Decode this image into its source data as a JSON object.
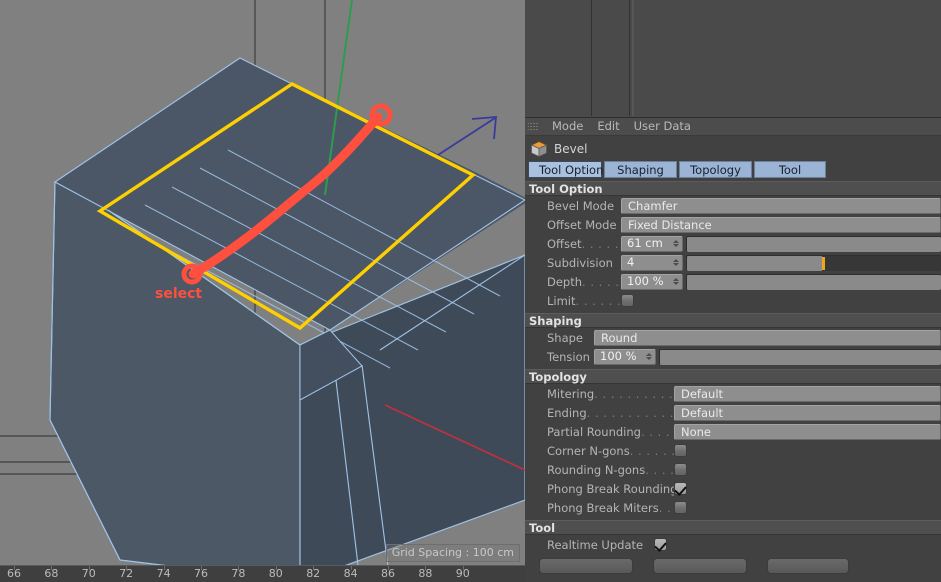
{
  "app": "Cinema 4D Attribute Manager",
  "viewport": {
    "annotation_label": "select",
    "grid_spacing": "Grid Spacing : 100 cm",
    "ruler_ticks": [
      "66",
      "68",
      "70",
      "72",
      "74",
      "76",
      "78",
      "80",
      "82",
      "84",
      "86",
      "88",
      "90"
    ],
    "colors": {
      "background": "#808080",
      "face_light": "#4e5a6b",
      "face_dark": "#44505f",
      "face_darkest": "#3b4654",
      "edge": "#9fc4e8",
      "selection": "#ffd000",
      "annotation": "#ff4f3f",
      "axis_y": "#2e9b4e",
      "axis_x": "#c62f3c",
      "axis_z": "#3a3a9e"
    }
  },
  "attribute_manager": {
    "menubar": {
      "grip": "grip-icon",
      "items": [
        "Mode",
        "Edit",
        "User Data"
      ]
    },
    "object": {
      "icon": "bevel-tool-icon",
      "name": "Bevel"
    },
    "tabs": [
      {
        "label": "Tool Option",
        "active": true
      },
      {
        "label": "Shaping",
        "active": false
      },
      {
        "label": "Topology",
        "active": false
      },
      {
        "label": "Tool",
        "active": false
      }
    ],
    "sections": [
      {
        "title": "Tool Option",
        "rows": [
          {
            "label": "Bevel Mode",
            "type": "dropdown",
            "value": "Chamfer"
          },
          {
            "label": "Offset Mode",
            "type": "dropdown",
            "value": "Fixed Distance"
          },
          {
            "label": "Offset",
            "dots": ". . . . .",
            "type": "number-slider",
            "value": "61 cm",
            "slider_percent": 100
          },
          {
            "label": "Subdivision",
            "dots": "",
            "type": "number-slider",
            "value": "4",
            "slider_percent": 53
          },
          {
            "label": "Depth",
            "dots": ". . . . .",
            "type": "number-slider",
            "value": "100 %",
            "slider_percent": 100
          },
          {
            "label": "Limit",
            "dots": ". . . . . .",
            "type": "checkbox",
            "checked": false
          }
        ]
      },
      {
        "title": "Shaping",
        "rows": [
          {
            "label": "Shape",
            "type": "dropdown",
            "value": "Round"
          },
          {
            "label": "Tension",
            "dots": "",
            "type": "number-slider",
            "value": "100 %",
            "slider_percent": 100
          }
        ]
      },
      {
        "title": "Topology",
        "rows": [
          {
            "label": "Mitering",
            "dots": ". . . . . . . . . . . .",
            "type": "dropdown",
            "value": "Default"
          },
          {
            "label": "Ending",
            "dots": ". . . . . . . . . . . . .",
            "type": "dropdown",
            "value": "Default"
          },
          {
            "label": "Partial Rounding",
            "dots": ". . . . .",
            "type": "dropdown",
            "value": "None"
          },
          {
            "label": "Corner N-gons",
            "dots": ". . . . . . .",
            "type": "checkbox",
            "checked": false
          },
          {
            "label": "Rounding N-gons",
            "dots": ". . . .",
            "type": "checkbox",
            "checked": false
          },
          {
            "label": "Phong Break Rounding",
            "dots": "",
            "type": "checkbox",
            "checked": true
          },
          {
            "label": "Phong Break Miters",
            "dots": ". .",
            "type": "checkbox",
            "checked": false
          }
        ]
      },
      {
        "title": "Tool",
        "rows": [
          {
            "label": "Realtime Update",
            "dots": "",
            "type": "checkbox",
            "checked": true
          }
        ]
      }
    ],
    "bottom_buttons": [
      "",
      "",
      ""
    ]
  }
}
